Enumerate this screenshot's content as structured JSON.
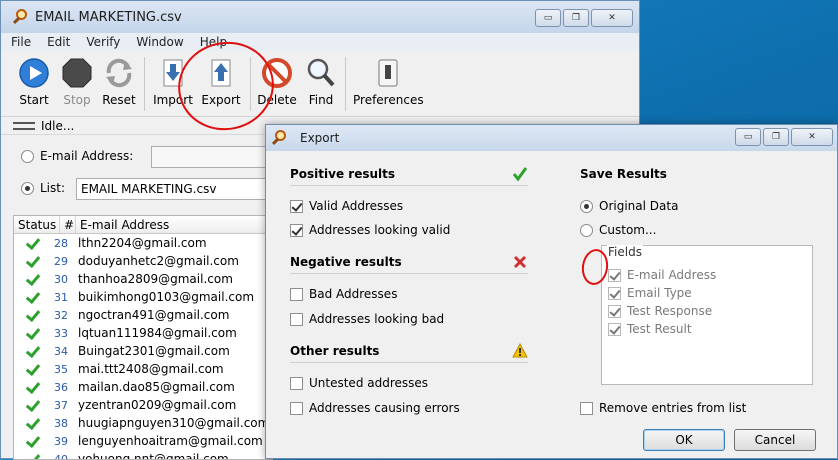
{
  "window": {
    "title": "EMAIL MARKETING.csv",
    "menu": [
      "File",
      "Edit",
      "Verify",
      "Window",
      "Help"
    ],
    "controls": {
      "minimize": "▭",
      "maximize": "❐",
      "close": "✕"
    }
  },
  "toolbar": {
    "start": "Start",
    "stop": "Stop",
    "reset": "Reset",
    "import": "Import",
    "export": "Export",
    "delete": "Delete",
    "find": "Find",
    "preferences": "Preferences"
  },
  "status": {
    "text": "Idle..."
  },
  "source": {
    "email_label": "E-mail Address:",
    "email_value": "",
    "list_label": "List:",
    "list_value": "EMAIL MARKETING.csv"
  },
  "grid": {
    "headers": {
      "status": "Status",
      "num": "#",
      "email": "E-mail Address"
    },
    "rows": [
      {
        "num": "28",
        "email": "lthn2204@gmail.com"
      },
      {
        "num": "29",
        "email": "doduyanhetc2@gmail.com"
      },
      {
        "num": "30",
        "email": "thanhoa2809@gmail.com"
      },
      {
        "num": "31",
        "email": "buikimhong0103@gmail.com"
      },
      {
        "num": "32",
        "email": "ngoctran491@gmail.com"
      },
      {
        "num": "33",
        "email": "lqtuan111984@gmail.com"
      },
      {
        "num": "34",
        "email": "Buingat2301@gmail.com"
      },
      {
        "num": "35",
        "email": "mai.ttt2408@gmail.com"
      },
      {
        "num": "36",
        "email": "mailan.dao85@gmail.com"
      },
      {
        "num": "37",
        "email": "yzentran0209@gmail.com"
      },
      {
        "num": "38",
        "email": "huugiapnguyen310@gmail.com"
      },
      {
        "num": "39",
        "email": "lenguyenhoaitram@gmail.com"
      },
      {
        "num": "40",
        "email": "vohuong.nnt@gmail.com"
      }
    ]
  },
  "export": {
    "title": "Export",
    "positive_title": "Positive results",
    "valid_addresses": "Valid Addresses",
    "looking_valid": "Addresses looking valid",
    "negative_title": "Negative results",
    "bad_addresses": "Bad Addresses",
    "looking_bad": "Addresses looking bad",
    "other_title": "Other results",
    "untested": "Untested addresses",
    "causing_errors": "Addresses causing errors",
    "save_title": "Save Results",
    "original_data": "Original Data",
    "custom": "Custom...",
    "fields_legend": "Fields",
    "fields": [
      "E-mail Address",
      "Email Type",
      "Test Response",
      "Test Result"
    ],
    "remove_entries": "Remove entries from list",
    "ok": "OK",
    "cancel": "Cancel"
  },
  "colors": {
    "check_green": "#2ea02e",
    "cross_red": "#d03030",
    "warning_yellow": "#f2c200",
    "annotation_red": "#e01010"
  }
}
